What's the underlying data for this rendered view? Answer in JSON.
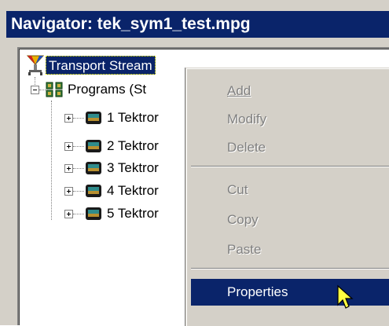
{
  "window": {
    "title": "Navigator: tek_sym1_test.mpg"
  },
  "tree": {
    "root_label": "Transport Stream",
    "programs_label": "Programs (St",
    "program_items": [
      {
        "label": "1 Tektror"
      },
      {
        "label": "2 Tektror"
      },
      {
        "label": "3 Tektror"
      },
      {
        "label": "4 Tektror"
      },
      {
        "label": "5 Tektror"
      }
    ]
  },
  "context_menu": {
    "add": "Add",
    "modify": "Modify",
    "delete": "Delete",
    "cut": "Cut",
    "copy": "Copy",
    "paste": "Paste",
    "properties": "Properties"
  },
  "colors": {
    "title_bar": "#0a246a",
    "selection": "#0a246a",
    "menu_bg": "#d4d0c8",
    "disabled_text": "#808080"
  }
}
